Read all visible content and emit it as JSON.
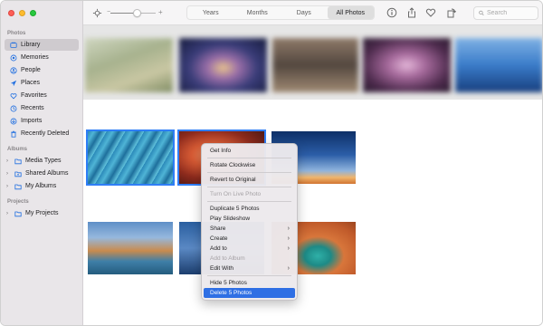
{
  "sidebar": {
    "sections": {
      "photos": "Photos",
      "albums": "Albums",
      "projects": "Projects"
    },
    "library_items": [
      {
        "label": "Library",
        "icon": "library-icon"
      },
      {
        "label": "Memories",
        "icon": "memories-icon"
      },
      {
        "label": "People",
        "icon": "people-icon"
      },
      {
        "label": "Places",
        "icon": "places-icon"
      },
      {
        "label": "Favorites",
        "icon": "favorites-icon"
      },
      {
        "label": "Recents",
        "icon": "recents-icon"
      },
      {
        "label": "Imports",
        "icon": "imports-icon"
      },
      {
        "label": "Recently Deleted",
        "icon": "trash-icon"
      }
    ],
    "album_items": [
      {
        "label": "Media Types",
        "icon": "folder-icon"
      },
      {
        "label": "Shared Albums",
        "icon": "cloud-folder-icon"
      },
      {
        "label": "My Albums",
        "icon": "folder-icon"
      }
    ],
    "project_items": [
      {
        "label": "My Projects",
        "icon": "folder-icon"
      }
    ],
    "selected": "Library"
  },
  "toolbar": {
    "zoom_minus": "−",
    "zoom_plus": "+",
    "zoom_level": 0.5,
    "tabs": [
      "Years",
      "Months",
      "Days",
      "All Photos"
    ],
    "active_tab": "All Photos",
    "search_placeholder": "Search"
  },
  "context_menu": {
    "items": [
      {
        "label": "Get Info"
      },
      {
        "sep": true
      },
      {
        "label": "Rotate Clockwise"
      },
      {
        "sep": true
      },
      {
        "label": "Revert to Original"
      },
      {
        "sep": true
      },
      {
        "label": "Turn On Live Photo",
        "disabled": true
      },
      {
        "sep": true
      },
      {
        "label": "Duplicate 5 Photos"
      },
      {
        "label": "Play Slideshow"
      },
      {
        "label": "Share",
        "submenu": true
      },
      {
        "label": "Create",
        "submenu": true
      },
      {
        "label": "Add to",
        "submenu": true
      },
      {
        "label": "Add to Album",
        "disabled": true
      },
      {
        "label": "Edit With",
        "submenu": true
      },
      {
        "sep": true
      },
      {
        "label": "Hide 5 Photos"
      },
      {
        "label": "Delete 5 Photos",
        "highlighted": true
      }
    ]
  },
  "colors": {
    "accent": "#2f7ef6",
    "highlight": "#2f6fe4",
    "sidebar_bg": "#e9e6e9",
    "icon_blue": "#1f6ee0"
  }
}
